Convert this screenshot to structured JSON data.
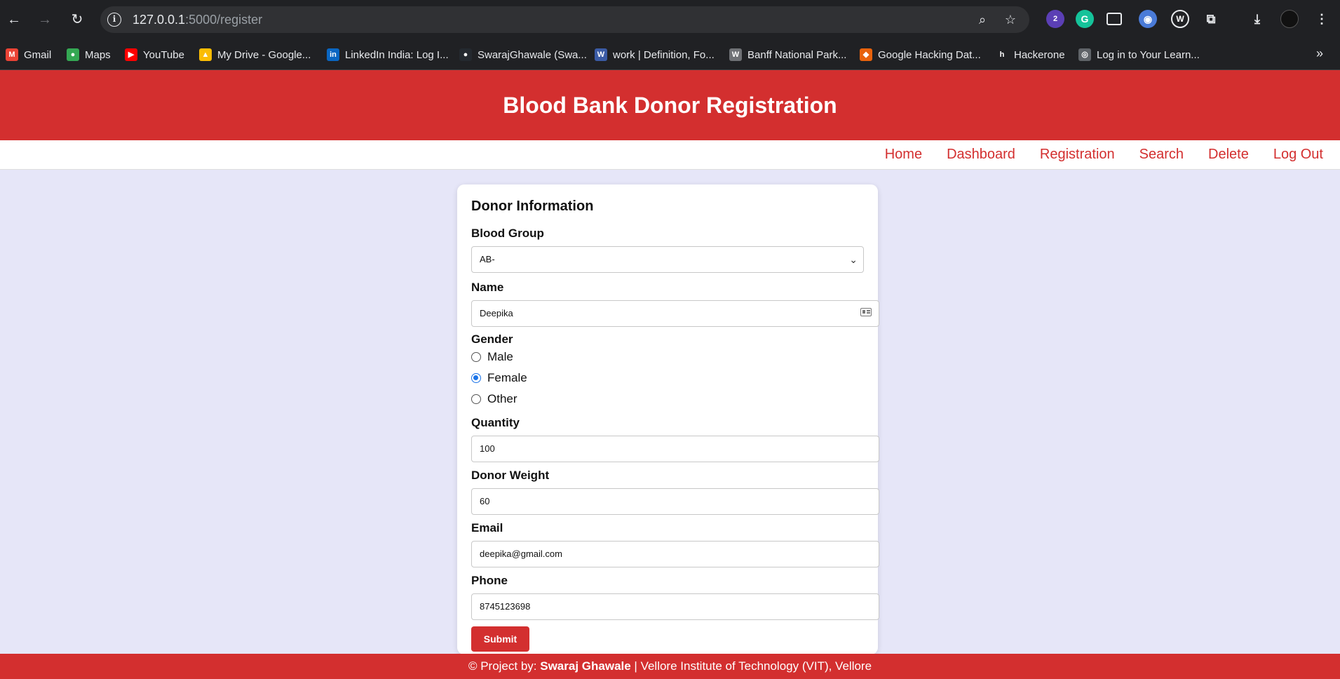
{
  "browser": {
    "url_host": "127.0.0.1",
    "url_path": ":5000/register"
  },
  "bookmarks": [
    {
      "label": "Gmail",
      "color": "#ea4335",
      "icon": "gmail-icon",
      "glyph": "M"
    },
    {
      "label": "Maps",
      "color": "#34a853",
      "icon": "maps-icon",
      "glyph": "●"
    },
    {
      "label": "YouTube",
      "color": "#ff0000",
      "icon": "youtube-icon",
      "glyph": "▶"
    },
    {
      "label": "My Drive - Google...",
      "color": "#fbbc04",
      "icon": "drive-icon",
      "glyph": "▲"
    },
    {
      "label": "LinkedIn India: Log I...",
      "color": "#0a66c2",
      "icon": "linkedin-icon",
      "glyph": "in"
    },
    {
      "label": "SwarajGhawale (Swa...",
      "color": "#24292f",
      "icon": "github-icon",
      "glyph": "●"
    },
    {
      "label": "work | Definition, Fo...",
      "color": "#3b5ba5",
      "icon": "dictionary-icon",
      "glyph": "W"
    },
    {
      "label": "Banff National Park...",
      "color": "#6f7175",
      "icon": "wiki-icon",
      "glyph": "W"
    },
    {
      "label": "Google Hacking Dat...",
      "color": "#e8620c",
      "icon": "exploit-db-icon",
      "glyph": "◆"
    },
    {
      "label": "Hackerone",
      "color": "#202124",
      "icon": "hackerone-icon",
      "glyph": "h"
    },
    {
      "label": "Log in to Your Learn...",
      "color": "#5f6368",
      "icon": "globe-icon",
      "glyph": "◎"
    }
  ],
  "header": {
    "title": "Blood Bank Donor Registration"
  },
  "nav": [
    "Home",
    "Dashboard",
    "Registration",
    "Search",
    "Delete",
    "Log Out"
  ],
  "form": {
    "title": "Donor Information",
    "blood_group": {
      "label": "Blood Group",
      "value": "AB-"
    },
    "name": {
      "label": "Name",
      "value": "Deepika"
    },
    "gender": {
      "label": "Gender",
      "options": [
        "Male",
        "Female",
        "Other"
      ],
      "selected": "Female"
    },
    "quantity": {
      "label": "Quantity",
      "value": "100"
    },
    "weight": {
      "label": "Donor Weight",
      "value": "60"
    },
    "email": {
      "label": "Email",
      "value": "deepika@gmail.com"
    },
    "phone": {
      "label": "Phone",
      "value": "8745123698"
    },
    "submit": "Submit"
  },
  "footer": {
    "prefix": "© Project by: ",
    "author": "Swaraj Ghawale",
    "suffix": " | Vellore Institute of Technology (VIT), Vellore"
  },
  "colors": {
    "brand": "#d32f2f",
    "background": "#e6e6f8"
  }
}
